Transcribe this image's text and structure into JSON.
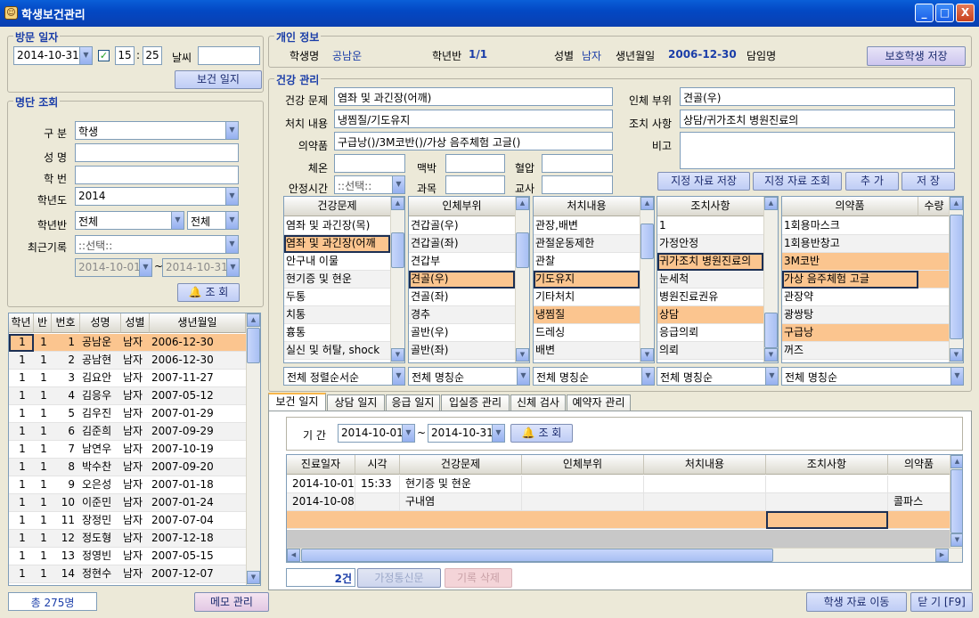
{
  "window": {
    "title": "학생보건관리",
    "minimize": "_",
    "maximize": "□",
    "close": "X"
  },
  "visit": {
    "legend": "방문 일자",
    "date": "2014-10-31",
    "checked": true,
    "hour": "15",
    "minute": "25",
    "weather_label": "날씨",
    "weather_value": "",
    "log_button": "보건 일지"
  },
  "roster": {
    "legend": "명단 조회",
    "category_label": "구 분",
    "category_value": "학생",
    "name_label": "성 명",
    "name_value": "",
    "number_label": "학 번",
    "number_value": "",
    "year_label": "학년도",
    "year_value": "2014",
    "class_label": "학년반",
    "class_value1": "전체",
    "class_value2": "전체",
    "recent_label": "최근기록",
    "recent_value": "::선택::",
    "date_from": "2014-10-01",
    "date_to": "2014-10-31",
    "tilde": "~",
    "search_button": "조 회"
  },
  "student_table": {
    "headers": [
      "학년",
      "반",
      "번호",
      "성명",
      "성별",
      "생년월일"
    ],
    "rows": [
      [
        "1",
        "1",
        "1",
        "공남운",
        "남자",
        "2006-12-30"
      ],
      [
        "1",
        "1",
        "2",
        "공남현",
        "남자",
        "2006-12-30"
      ],
      [
        "1",
        "1",
        "3",
        "김요안",
        "남자",
        "2007-11-27"
      ],
      [
        "1",
        "1",
        "4",
        "김응우",
        "남자",
        "2007-05-12"
      ],
      [
        "1",
        "1",
        "5",
        "김우진",
        "남자",
        "2007-01-29"
      ],
      [
        "1",
        "1",
        "6",
        "김준희",
        "남자",
        "2007-09-29"
      ],
      [
        "1",
        "1",
        "7",
        "남연우",
        "남자",
        "2007-10-19"
      ],
      [
        "1",
        "1",
        "8",
        "박수찬",
        "남자",
        "2007-09-20"
      ],
      [
        "1",
        "1",
        "9",
        "오은성",
        "남자",
        "2007-01-18"
      ],
      [
        "1",
        "1",
        "10",
        "이준민",
        "남자",
        "2007-01-24"
      ],
      [
        "1",
        "1",
        "11",
        "장정민",
        "남자",
        "2007-07-04"
      ],
      [
        "1",
        "1",
        "12",
        "정도형",
        "남자",
        "2007-12-18"
      ],
      [
        "1",
        "1",
        "13",
        "정영빈",
        "남자",
        "2007-05-15"
      ],
      [
        "1",
        "1",
        "14",
        "정현수",
        "남자",
        "2007-12-07"
      ]
    ],
    "total": "총 275명",
    "memo_button": "메모 관리"
  },
  "personal": {
    "legend": "개인 정보",
    "name_label": "학생명",
    "name": "공남운",
    "class_label": "학년반",
    "class": "1/1",
    "gender_label": "성별",
    "gender": "남자",
    "birth_label": "생년월일",
    "birth": "2006-12-30",
    "teacher_label": "담임명",
    "teacher": "",
    "save_button": "보호학생 저장"
  },
  "health": {
    "legend": "건강 관리",
    "problem_label": "건강 문제",
    "problem": "염좌 및 과긴장(어깨)",
    "body_label": "인체 부위",
    "body": "견골(우)",
    "treatment_label": "처치 내용",
    "treatment": "냉찜질/기도유지",
    "action_label": "조치 사항",
    "action": "상담/귀가조치 병원진료의",
    "medicine_label": "의약품",
    "medicine": "구급낭()/3M코반()/가상 음주체험 고글()",
    "note_label": "비고",
    "note": "",
    "temp_label": "체온",
    "pulse_label": "맥박",
    "bp_label": "혈압",
    "rest_label": "안정시간",
    "rest_value": "::선택::",
    "subject_label": "과목",
    "teacher_label": "교사",
    "btn_save_designated": "지정 자료 저장",
    "btn_view_designated": "지정 자료 조회",
    "btn_add": "추 가",
    "btn_save": "저 장"
  },
  "lists": {
    "problems": {
      "header": "건강문제",
      "items": [
        "염좌 및 과긴장(목)",
        "염좌 및 과긴장(어깨",
        "안구내 이물",
        "현기증 및 현운",
        "두통",
        "치통",
        "흉통",
        "실신 및 허탈, shock"
      ],
      "sort": "전체 정렬순서순"
    },
    "body": {
      "header": "인체부위",
      "items": [
        "견갑골(우)",
        "견갑골(좌)",
        "견갑부",
        "견골(우)",
        "견골(좌)",
        "경추",
        "골반(우)",
        "골반(좌)"
      ],
      "sort": "전체 명칭순"
    },
    "treatment": {
      "header": "처치내용",
      "items": [
        "관장,배변",
        "관절운동제한",
        "관찰",
        "기도유지",
        "기타처치",
        "냉찜질",
        "드레싱",
        "배변"
      ],
      "sort": "전체 명칭순"
    },
    "action": {
      "header": "조치사항",
      "items": [
        "1",
        "가정안정",
        "귀가조치 병원진료의",
        "눈세척",
        "병원진료권유",
        "상담",
        "응급의뢰",
        "의뢰"
      ],
      "sort": "전체 명칭순"
    },
    "medicine": {
      "header": "의약품",
      "header2": "수량",
      "items": [
        "1회용마스크",
        "1회용반창고",
        "3M코반",
        "가상 음주체험 고글",
        "관장약",
        "광쌍탕",
        "구급낭",
        "꺼즈"
      ],
      "sort": "전체 명칭순"
    }
  },
  "tabs": [
    "보건 일지",
    "상담 일지",
    "응급 일지",
    "입실증 관리",
    "신체 검사",
    "예약자 관리"
  ],
  "log": {
    "period_label": "기 간",
    "from": "2014-10-01",
    "to": "2014-10-31",
    "tilde": "~",
    "search_button": "조 회",
    "headers": [
      "진료일자",
      "시각",
      "건강문제",
      "인체부위",
      "처치내용",
      "조치사항",
      "의약품"
    ],
    "rows": [
      [
        "2014-10-01",
        "15:33",
        "현기증 및 현운",
        "",
        "",
        "",
        ""
      ],
      [
        "2014-10-08",
        "",
        "구내염",
        "",
        "",
        "",
        "콜파스"
      ]
    ],
    "count": "2건",
    "btn_home_notice": "가정통신문",
    "btn_delete": "기록 삭제"
  },
  "footer": {
    "btn_move": "학생 자료 이동",
    "btn_close": "닫 기 [F9]"
  },
  "colors": {
    "highlight": "#fbc58f",
    "accent": "#1a3da8",
    "title_bar": "#0348c4"
  }
}
